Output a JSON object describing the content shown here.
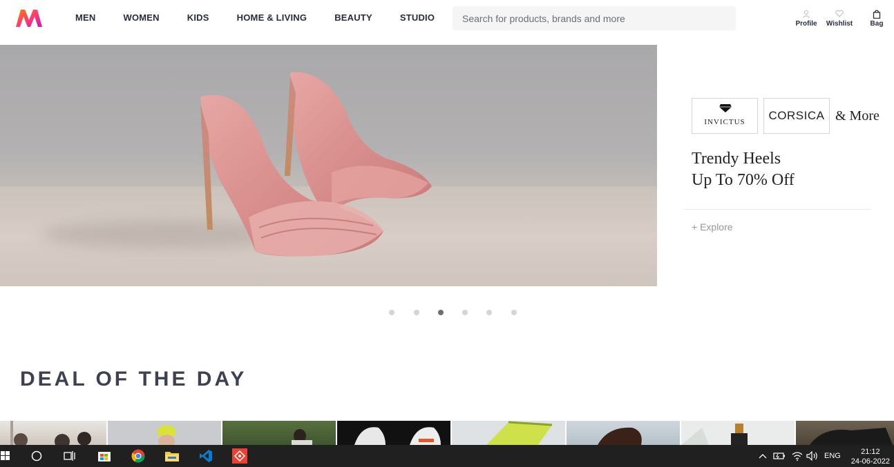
{
  "header": {
    "nav": [
      "MEN",
      "WOMEN",
      "KIDS",
      "HOME & LIVING",
      "BEAUTY",
      "STUDIO"
    ],
    "search_placeholder": "Search for products, brands and more",
    "actions": {
      "profile": "Profile",
      "wishlist": "Wishlist",
      "bag": "Bag"
    }
  },
  "banner": {
    "brands": {
      "brand1": "INVICTUS",
      "brand2": "CORSICA",
      "more": "& More"
    },
    "headline_line1": "Trendy Heels",
    "headline_line2": "Up To 70% Off",
    "explore": "+ Explore",
    "slides_count": 6,
    "active_slide": 3
  },
  "deal_section": {
    "title": "DEAL OF THE DAY"
  },
  "taskbar": {
    "language": "ENG",
    "time": "21:12",
    "date": "24-06-2022"
  },
  "colors": {
    "accent": "#ff3f6c",
    "text": "#282c3f",
    "muted": "#94969f",
    "taskbar": "#202020"
  },
  "icons": [
    "myntra-logo",
    "profile-icon",
    "wishlist-icon",
    "bag-icon",
    "windows-start-icon",
    "search-circle-icon",
    "task-view-icon",
    "store-icon",
    "chrome-icon",
    "file-explorer-icon",
    "vscode-icon",
    "git-icon",
    "chevron-up-icon",
    "battery-icon",
    "wifi-icon",
    "volume-icon"
  ]
}
